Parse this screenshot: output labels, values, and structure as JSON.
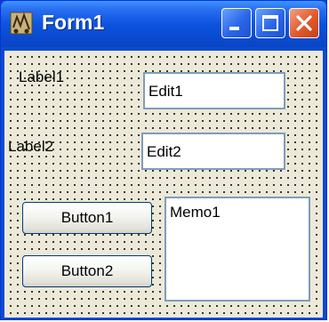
{
  "window": {
    "title": "Form1",
    "icon": "app-icon",
    "controls": [
      "minimize-icon",
      "maximize-icon",
      "close-icon"
    ]
  },
  "form": {
    "label1": "Label1",
    "edit1": "Edit1",
    "label2": "Label2",
    "edit2": "Edit2",
    "button1": "Button1",
    "button2": "Button2",
    "memo1": "Memo1"
  }
}
